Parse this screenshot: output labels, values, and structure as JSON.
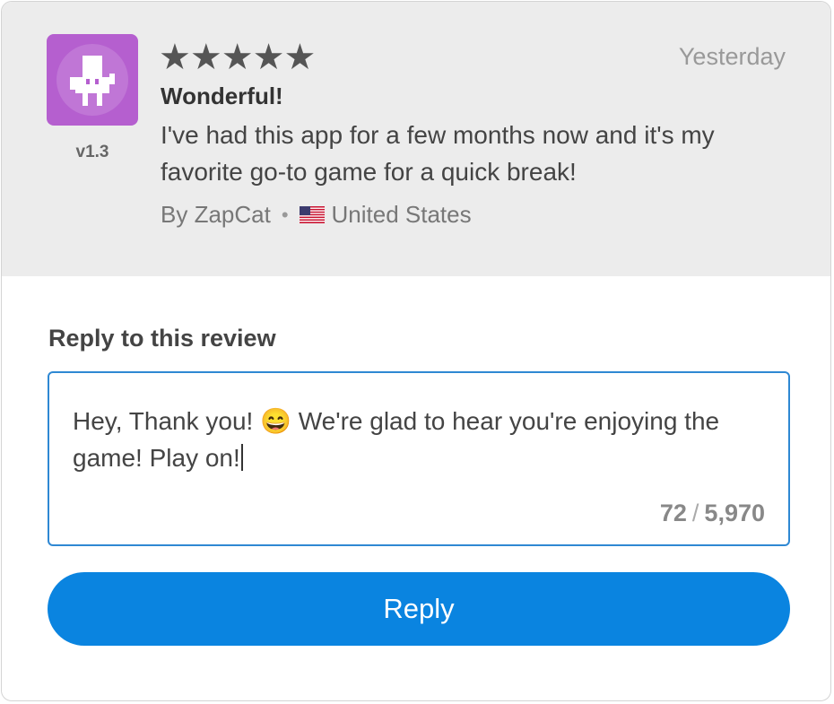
{
  "review": {
    "app_version": "v1.3",
    "stars": "★★★★★",
    "rating": 5,
    "date": "Yesterday",
    "title": "Wonderful!",
    "body": "I've had this app for a few months now and it's my favorite go-to game for a quick break!",
    "author": "By ZapCat",
    "separator": "•",
    "country": "United States",
    "country_flag_icon": "us-flag-icon",
    "app_icon": "robot-app-icon"
  },
  "reply": {
    "label": "Reply to this review",
    "text_before_emoji": "Hey, Thank you! ",
    "emoji": "😄",
    "text_after_emoji": " We're glad to hear you're enjoying the game! Play on!",
    "char_count": "72",
    "count_separator": "/",
    "char_limit": "5,970",
    "button_label": "Reply"
  },
  "colors": {
    "accent": "#0a84e0",
    "input_border": "#2f88d3",
    "app_icon_bg": "#b55fcf",
    "review_bg": "#ececec"
  }
}
